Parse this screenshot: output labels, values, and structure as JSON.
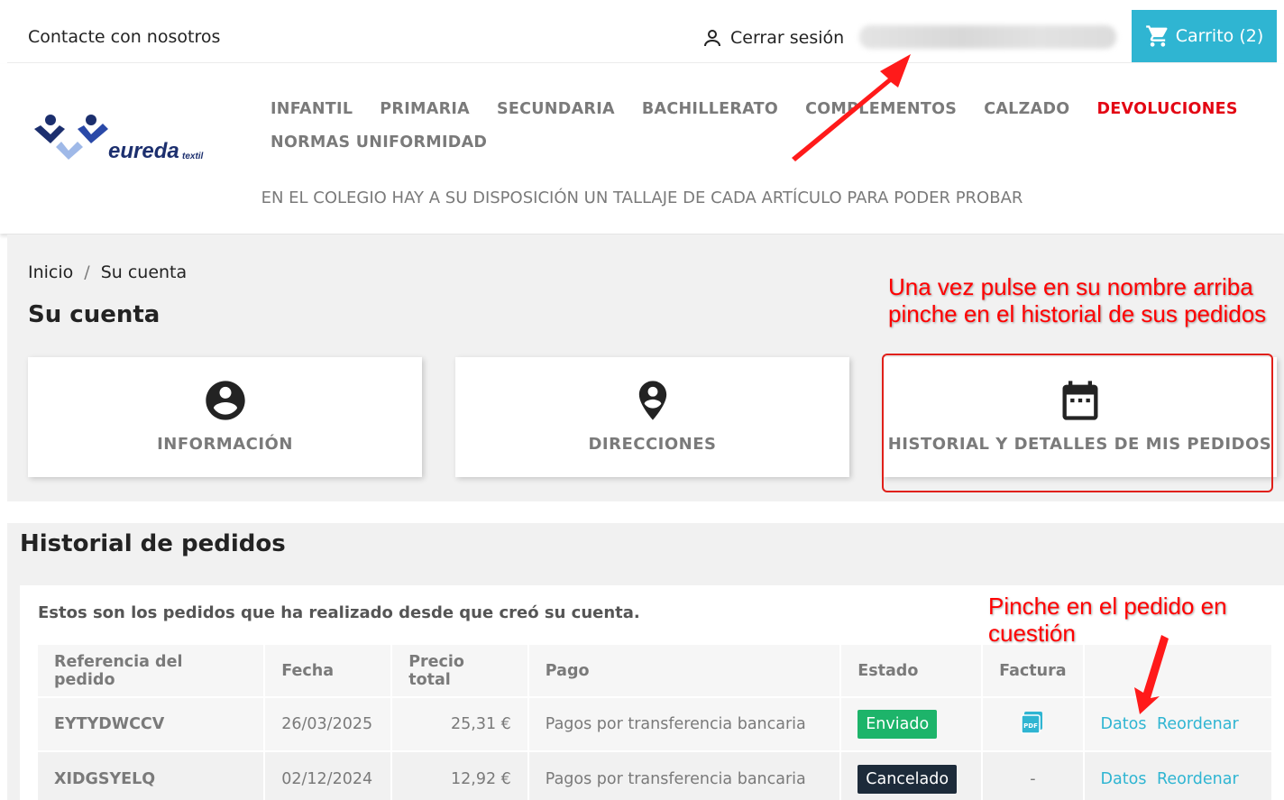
{
  "topbar": {
    "contact": "Contacte con nosotros",
    "logout": "Cerrar sesión",
    "cart": "Carrito (2)"
  },
  "brand": {
    "logo_text": "eureda",
    "logo_sub": "textil"
  },
  "nav": {
    "row1": [
      "INFANTIL",
      "PRIMARIA",
      "SECUNDARIA",
      "BACHILLERATO",
      "COMPLEMENTOS",
      "CALZADO",
      "DEVOLUCIONES"
    ],
    "row2": [
      "NORMAS UNIFORMIDAD"
    ]
  },
  "notice": "EN EL COLEGIO HAY A SU DISPOSICIÓN UN TALLAJE DE CADA ARTÍCULO PARA PODER PROBAR",
  "breadcrumb": {
    "home": "Inicio",
    "sep": "/",
    "current": "Su cuenta"
  },
  "account": {
    "title": "Su cuenta",
    "cards": [
      {
        "label": "INFORMACIÓN",
        "icon": "account-circle-icon"
      },
      {
        "label": "DIRECCIONES",
        "icon": "location-pin-icon"
      },
      {
        "label": "HISTORIAL Y DETALLES DE MIS PEDIDOS",
        "icon": "calendar-icon"
      }
    ]
  },
  "annotations": {
    "first": "Una vez pulse en su nombre arriba pinche en el historial de sus pedidos",
    "second": "Pinche en el pedido en cuestión"
  },
  "orders": {
    "title": "Historial de pedidos",
    "intro": "Estos son los pedidos que ha realizado desde que creó su cuenta.",
    "columns": [
      "Referencia del pedido",
      "Fecha",
      "Precio total",
      "Pago",
      "Estado",
      "Factura",
      ""
    ],
    "rows": [
      {
        "ref": "EYTYDWCCV",
        "date": "26/03/2025",
        "total": "25,31 €",
        "payment": "Pagos por transferencia bancaria",
        "status": "Enviado",
        "invoice": "",
        "details": "Datos",
        "reorder": "Reordenar"
      },
      {
        "ref": "XIDGSYELQ",
        "date": "02/12/2024",
        "total": "12,92 €",
        "payment": "Pagos por transferencia bancaria",
        "status": "Cancelado",
        "invoice": "-",
        "details": "Datos",
        "reorder": "Reordenar"
      }
    ]
  },
  "colors": {
    "accent": "#2fb5d2",
    "returns": "#e30613",
    "status_shipped": "#1db46a",
    "status_cancelled": "#1d2b3a",
    "annotation": "#ff0000"
  }
}
